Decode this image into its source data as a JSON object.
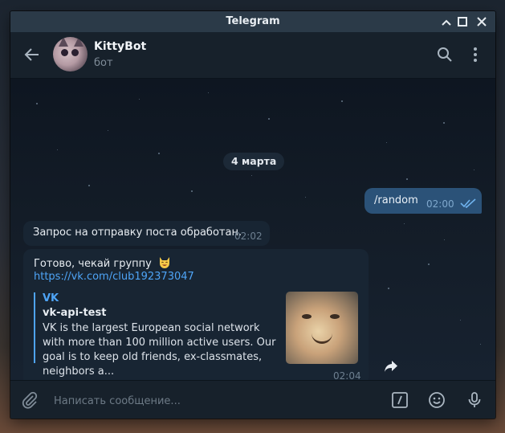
{
  "window": {
    "title": "Telegram"
  },
  "header": {
    "chat_name": "KittyBot",
    "chat_status": "бот"
  },
  "chat": {
    "date_badge": "4 марта",
    "messages": [
      {
        "direction": "out",
        "text": "/random",
        "time": "02:00",
        "read": true
      },
      {
        "direction": "in",
        "text": "Запрос на отправку поста обработан.",
        "time": "02:02"
      },
      {
        "direction": "in",
        "text": "Готово, чекай группу",
        "emoji": "smiling-cat-emoji",
        "link": "https://vk.com/club192373047",
        "time": "02:04",
        "preview": {
          "site": "VK",
          "title": "vk-api-test",
          "description": "VK is the largest European social network with more than 100 million active users. Our goal is to keep old friends, ex-classmates, neighbors a..."
        }
      }
    ]
  },
  "composer": {
    "placeholder": "Написать сообщение..."
  },
  "colors": {
    "accent": "#4ea4f6",
    "outgoing_bubble": "#2b5278",
    "incoming_bubble": "#182533",
    "header_bg": "#17212b",
    "titlebar_bg": "#2b3a48"
  }
}
